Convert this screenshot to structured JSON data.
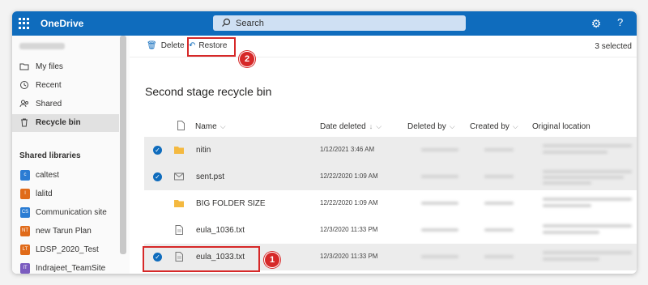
{
  "app": {
    "name": "OneDrive"
  },
  "search": {
    "placeholder": "Search"
  },
  "header": {
    "help_label": "?"
  },
  "sidebar": {
    "nav": [
      {
        "label": "My files",
        "icon": "folder-icon"
      },
      {
        "label": "Recent",
        "icon": "clock-icon"
      },
      {
        "label": "Shared",
        "icon": "people-icon"
      },
      {
        "label": "Recycle bin",
        "icon": "recycle-bin-icon"
      }
    ],
    "shared_header": "Shared libraries",
    "libraries": [
      {
        "label": "caltest",
        "color": "#2b7cd3",
        "abbr": "c"
      },
      {
        "label": "lalitd",
        "color": "#e06b1a",
        "abbr": "l"
      },
      {
        "label": "Communication site",
        "color": "#2b7cd3",
        "abbr": "CS"
      },
      {
        "label": "new Tarun Plan",
        "color": "#e06b1a",
        "abbr": "NT"
      },
      {
        "label": "LDSP_2020_Test",
        "color": "#e06b1a",
        "abbr": "LT"
      },
      {
        "label": "Indrajeet_TeamSite",
        "color": "#7a5bbf",
        "abbr": "IT"
      }
    ]
  },
  "commandbar": {
    "delete_label": "Delete",
    "restore_label": "Restore",
    "selected_count": "3 selected"
  },
  "annotations": {
    "badge1": "1",
    "badge2": "2"
  },
  "page": {
    "title": "Second stage recycle bin"
  },
  "columns": {
    "name": "Name",
    "date_deleted": "Date deleted",
    "deleted_by": "Deleted by",
    "created_by": "Created by",
    "original_location": "Original location"
  },
  "rows": [
    {
      "name": "nitin",
      "date": "1/12/2021 3:46 AM",
      "type": "folder",
      "selected": true
    },
    {
      "name": "sent.pst",
      "date": "12/22/2020 1:09 AM",
      "type": "mail",
      "selected": true
    },
    {
      "name": "BIG FOLDER SIZE",
      "date": "12/22/2020 1:09 AM",
      "type": "folder",
      "selected": false
    },
    {
      "name": "eula_1036.txt",
      "date": "12/3/2020 11:33 PM",
      "type": "file",
      "selected": false
    },
    {
      "name": "eula_1033.txt",
      "date": "12/3/2020 11:33 PM",
      "type": "file",
      "selected": true
    }
  ],
  "colors": {
    "brand": "#0f6cbd",
    "highlight": "#d62828",
    "folder": "#f4b940"
  }
}
